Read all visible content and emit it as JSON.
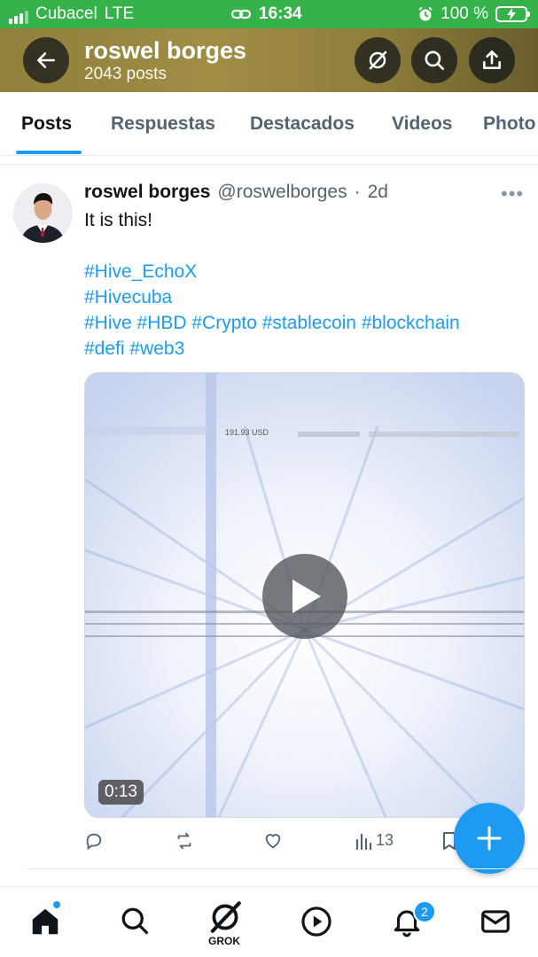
{
  "status_bar": {
    "carrier": "Cubacel",
    "network": "LTE",
    "time": "16:34",
    "battery": "100 %"
  },
  "header": {
    "title": "roswel borges",
    "subtitle": "2043 posts"
  },
  "tabs": [
    {
      "label": "Posts",
      "active": true
    },
    {
      "label": "Respuestas"
    },
    {
      "label": "Destacados"
    },
    {
      "label": "Videos"
    },
    {
      "label": "Photo"
    }
  ],
  "tweet": {
    "name": "roswel borges",
    "handle": "@roswelborges",
    "dot": "·",
    "age": "2d",
    "more": "•••",
    "text_lines": [
      "It is this!",
      "",
      "#Hive_EchoX",
      "#Hivecuba",
      "#Hive #HBD #Crypto #stablecoin #blockchain",
      "#defi #web3"
    ],
    "video": {
      "overlay_label": "191.93 USD",
      "duration": "0:13"
    },
    "views": "13"
  },
  "bottom_nav": {
    "grok_label": "GROK",
    "notifications_badge": "2"
  },
  "colors": {
    "accent": "#1d9bf0",
    "status_bar": "#35b34a",
    "header_banner": "#9b8a42"
  }
}
